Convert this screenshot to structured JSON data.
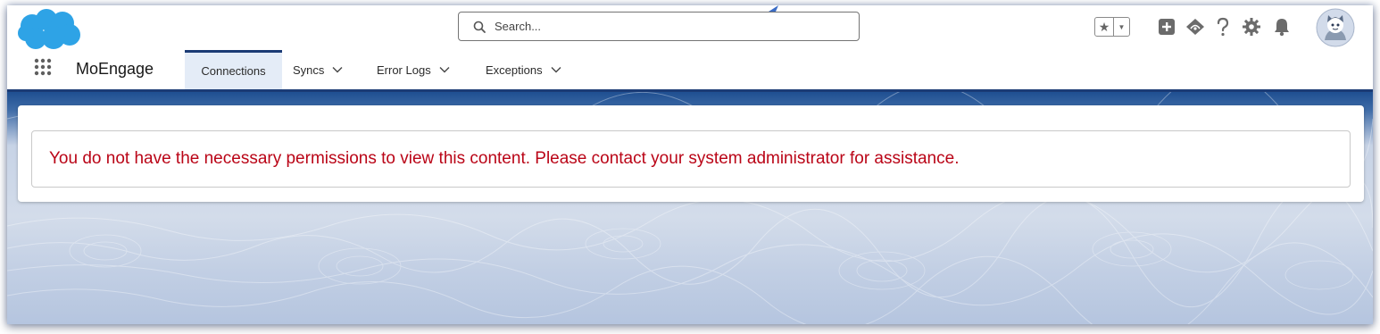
{
  "header": {
    "search": {
      "placeholder": "Search..."
    },
    "icons": [
      "favorites-star-icon",
      "favorites-list-icon",
      "global-actions-add-icon",
      "guidance-center-icon",
      "help-icon",
      "setup-gear-icon",
      "notifications-bell-icon",
      "user-avatar-icon"
    ]
  },
  "app_nav": {
    "app_name": "MoEngage",
    "tabs": [
      {
        "label": "Connections",
        "active": true,
        "has_menu": false
      },
      {
        "label": "Syncs",
        "active": false,
        "has_menu": true
      },
      {
        "label": "Error Logs",
        "active": false,
        "has_menu": true
      },
      {
        "label": "Exceptions",
        "active": false,
        "has_menu": true
      }
    ]
  },
  "content": {
    "error_message": "You do not have the necessary permissions to view this content. Please contact your system administrator for assistance."
  },
  "colors": {
    "brand_blue": "#1b3b75",
    "cloud_blue": "#2ea3e6",
    "error_red": "#ba0517",
    "active_tab_bg": "#e4ecf7",
    "annotation_arrow": "#3b6cc5"
  }
}
